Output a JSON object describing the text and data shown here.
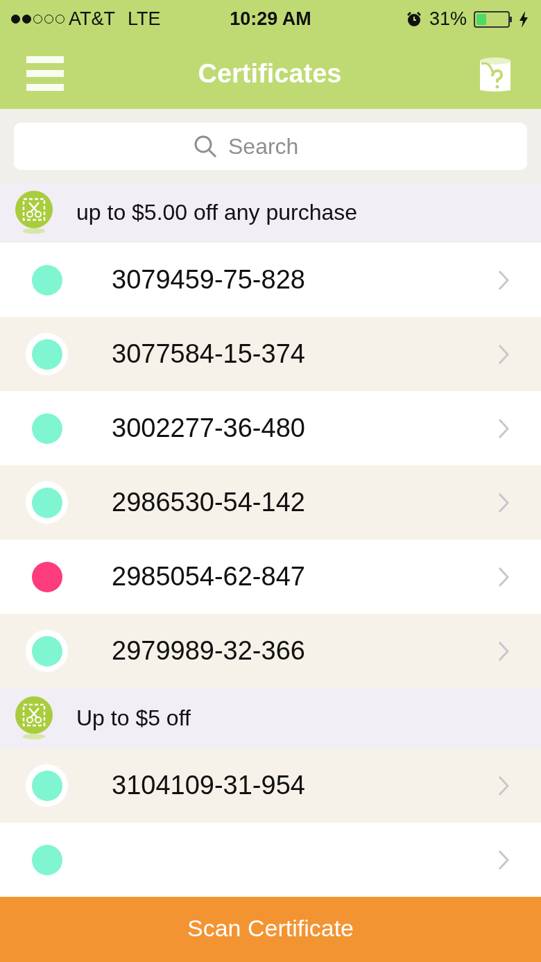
{
  "status_bar": {
    "signal_dots": [
      {
        "filled": true
      },
      {
        "filled": true
      },
      {
        "filled": false
      },
      {
        "filled": false
      },
      {
        "filled": false
      }
    ],
    "carrier": "AT&T",
    "network": "LTE",
    "time": "10:29 AM",
    "battery_percent": "31%",
    "battery": {
      "level": 0.31
    }
  },
  "nav_bar": {
    "title": "Certificates"
  },
  "search": {
    "placeholder": "Search"
  },
  "groups": [
    {
      "title": "up to $5.00 off any purchase",
      "items": [
        {
          "number": "3079459-75-828",
          "color": "#80f5d2"
        },
        {
          "number": "3077584-15-374",
          "color": "#80f5d2"
        },
        {
          "number": "3002277-36-480",
          "color": "#80f5d2"
        },
        {
          "number": "2986530-54-142",
          "color": "#80f5d2"
        },
        {
          "number": "2985054-62-847",
          "color": "#fc3c7c"
        },
        {
          "number": "2979989-32-366",
          "color": "#80f5d2"
        }
      ]
    },
    {
      "title": "Up to $5 off",
      "items": [
        {
          "number": "3104109-31-954",
          "color": "#80f5d2"
        },
        {
          "color": "#80f5d2"
        }
      ]
    }
  ],
  "scan_button": {
    "label": "Scan Certificate"
  }
}
